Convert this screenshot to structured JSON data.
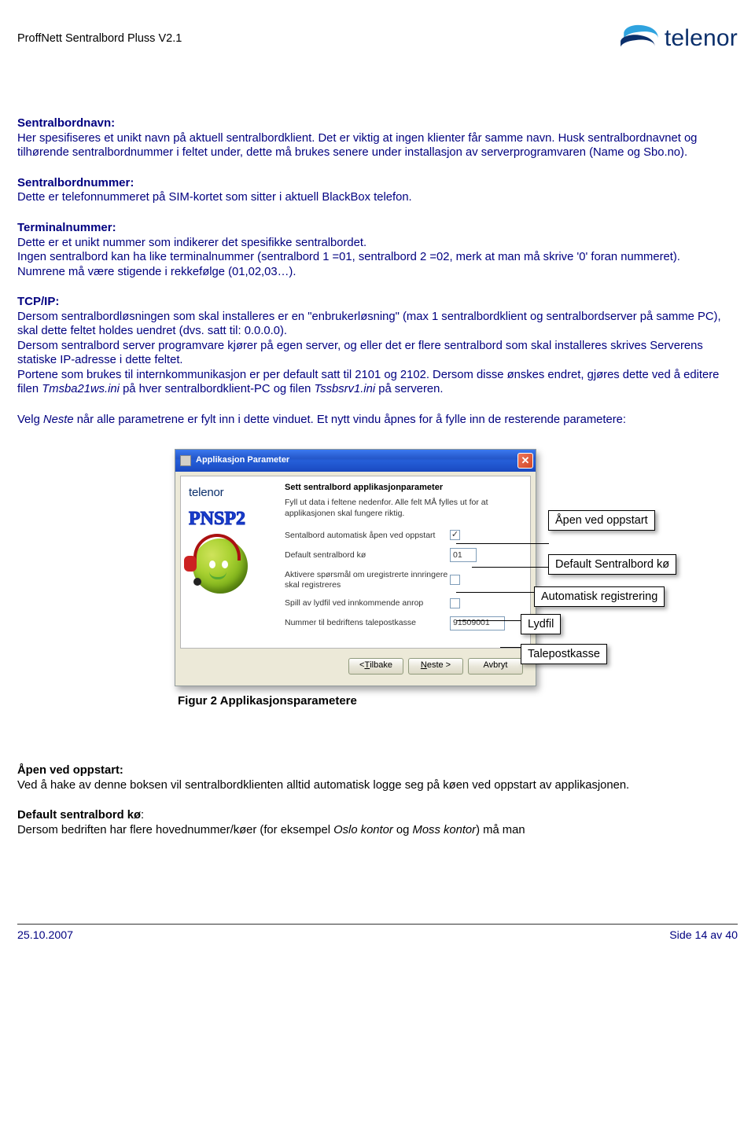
{
  "header": {
    "doc_title": "ProffNett Sentralbord Pluss V2.1",
    "brand": "telenor"
  },
  "sections": {
    "sentralbordnavn": {
      "heading": "Sentralbordnavn:",
      "p1": "Her spesifiseres et unikt navn på aktuell sentralbordklient. Det er viktig at ingen klienter får samme navn. Husk sentralbordnavnet og tilhørende sentralbordnummer i feltet under, dette må brukes senere under installasjon av serverprogramvaren (Name og Sbo.no)."
    },
    "sentralbordnummer": {
      "heading": "Sentralbordnummer:",
      "p1": "Dette er telefonnummeret på SIM-kortet som sitter i aktuell BlackBox telefon."
    },
    "terminalnummer": {
      "heading": "Terminalnummer:",
      "p1": "Dette er et unikt nummer som indikerer det spesifikke sentralbordet.",
      "p2": "Ingen sentralbord kan ha like terminalnummer (sentralbord 1 =01, sentralbord 2 =02, merk at man må skrive '0' foran nummeret). Numrene må være stigende i rekkefølge (01,02,03…)."
    },
    "tcpip": {
      "heading": "TCP/IP:",
      "p1": "Dersom sentralbordløsningen som skal installeres er en \"enbrukerløsning\" (max 1 sentralbordklient og sentralbordserver på samme PC), skal dette feltet holdes uendret (dvs. satt til: 0.0.0.0).",
      "p2": "Dersom sentralbord server programvare kjører på egen server, og eller det er flere sentralbord som skal installeres skrives Serverens statiske IP-adresse i dette feltet.",
      "p3a": "Portene som brukes til internkommunikasjon er per default satt til 2101 og 2102. Dersom disse ønskes endret, gjøres dette ved å editere filen ",
      "p3b": "Tmsba21ws.ini",
      "p3c": " på hver sentralbordklient-PC og filen ",
      "p3d": "Tssbsrv1.ini",
      "p3e": " på serveren."
    },
    "velgneste": {
      "a": "Velg ",
      "b": "Neste",
      "c": " når alle parametrene er fylt inn i dette vinduet. Et nytt vindu åpnes for å fylle inn de resterende parametere:"
    },
    "apen": {
      "heading": "Åpen ved oppstart:",
      "p1": "Ved å hake av denne boksen vil sentralbordklienten alltid automatisk logge seg på køen ved oppstart av applikasjonen."
    },
    "defaultko": {
      "heading": "Default sentralbord kø",
      "colon": ":",
      "p1a": "Dersom bedriften har flere hovednummer/køer (for eksempel ",
      "p1b": "Oslo kontor",
      "p1c": " og ",
      "p1d": "Moss kontor",
      "p1e": ") må man"
    }
  },
  "dialog": {
    "title": "Applikasjon Parameter",
    "panel_title": "Sett sentralbord applikasjonparameter",
    "panel_sub": "Fyll ut data i feltene nedenfor. Alle felt MÅ fylles ut for at applikasjonen skal fungere riktig.",
    "brand_small": "telenor",
    "pnsp2": "PNSP2",
    "rows": {
      "auto_open": {
        "label": "Sentalbord automatisk åpen ved oppstart",
        "checked": "✓"
      },
      "default_queue": {
        "label": "Default sentralbord kø",
        "value": "01"
      },
      "register": {
        "label": "Aktivere spørsmål om uregistrerte innringere skal registreres",
        "checked": ""
      },
      "sound": {
        "label": "Spill av lydfil ved innkommende anrop",
        "checked": ""
      },
      "voicemail": {
        "label": "Nummer til bedriftens talepostkasse",
        "value": "91509001"
      }
    },
    "buttons": {
      "back_prefix": "< ",
      "back_u": "T",
      "back_rest": "ilbake",
      "next_u": "N",
      "next_rest": "este >",
      "cancel": "Avbryt"
    }
  },
  "callouts": {
    "c1": "Åpen ved oppstart",
    "c2": "Default Sentralbord kø",
    "c3": "Automatisk registrering",
    "c4": "Lydfil",
    "c5": "Talepostkasse"
  },
  "figure_caption": "Figur 2 Applikasjonsparametere",
  "footer": {
    "date": "25.10.2007",
    "page": "Side 14 av 40"
  }
}
